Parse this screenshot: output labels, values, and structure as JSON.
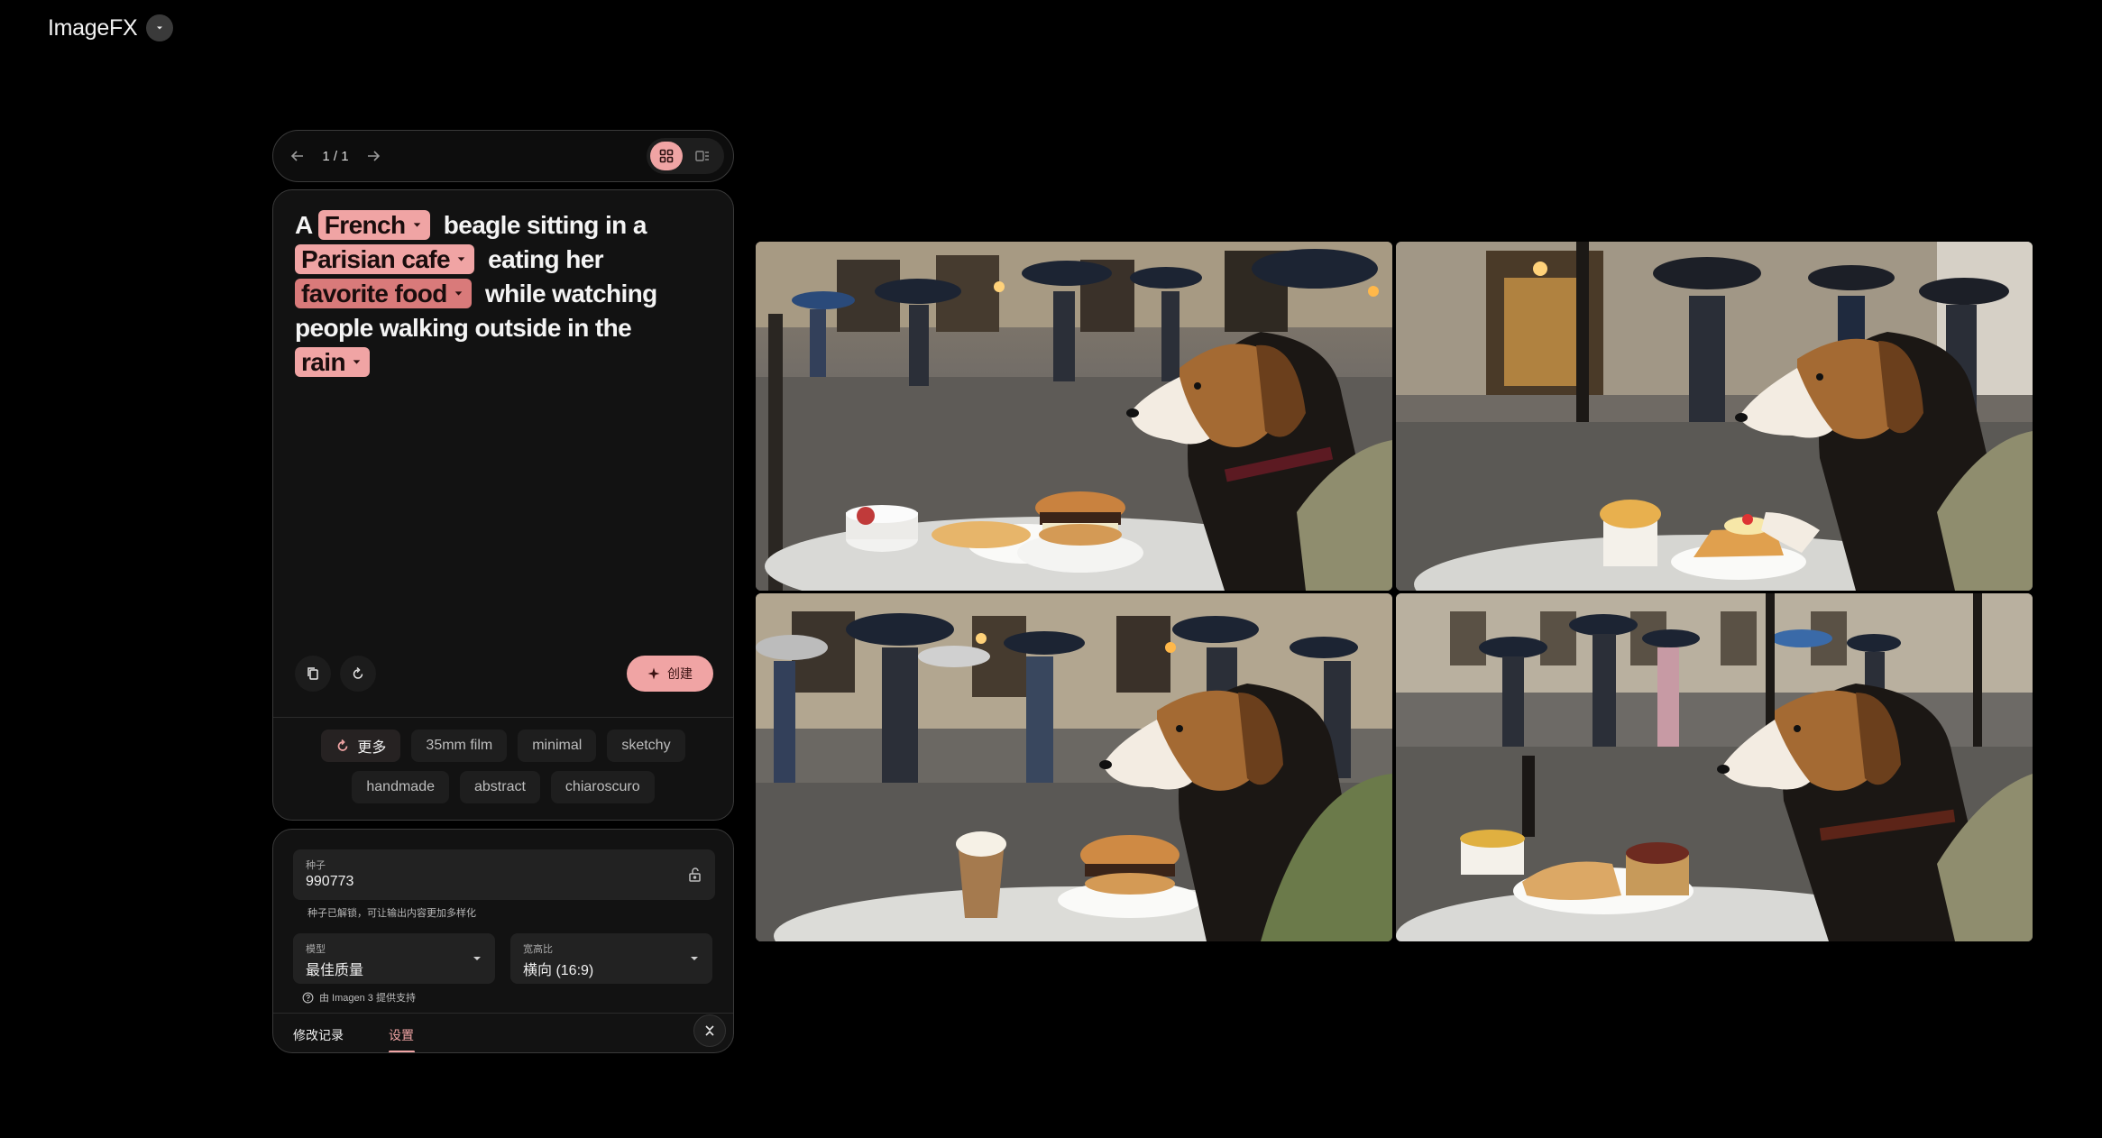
{
  "app": {
    "title": "ImageFX"
  },
  "pager": {
    "position": "1 / 1"
  },
  "prompt": {
    "segments": [
      {
        "type": "text",
        "value": "A"
      },
      {
        "type": "chip",
        "value": "French"
      },
      {
        "type": "text",
        "value": "beagle sitting in a"
      },
      {
        "type": "chip",
        "value": "Parisian cafe"
      },
      {
        "type": "text",
        "value": "eating her"
      },
      {
        "type": "chip",
        "value": "favorite food"
      },
      {
        "type": "text",
        "value": "while watching people walking outside in the"
      },
      {
        "type": "chip",
        "value": "rain"
      }
    ]
  },
  "actions": {
    "create_label": "创建"
  },
  "styles": {
    "more_label": "更多",
    "items": [
      "35mm film",
      "minimal",
      "sketchy",
      "handmade",
      "abstract",
      "chiaroscuro"
    ]
  },
  "settings": {
    "seed": {
      "label": "种子",
      "value": "990773",
      "hint": "种子已解锁，可让输出内容更加多样化"
    },
    "model": {
      "label": "模型",
      "value": "最佳质量"
    },
    "aspect_ratio": {
      "label": "宽高比",
      "value": "横向 (16:9)"
    },
    "powered_by": "由 Imagen 3 提供支持"
  },
  "tabs": {
    "history": "修改记录",
    "settings": "设置"
  },
  "colors": {
    "accent": "#f0a4a4",
    "background": "#000000",
    "card": "#121212"
  },
  "icons": [
    "chevron-down-icon",
    "arrow-left-icon",
    "arrow-right-icon",
    "grid-view-icon",
    "list-view-icon",
    "copy-icon",
    "reset-icon",
    "sparkle-icon",
    "refresh-icon",
    "unlock-icon",
    "info-icon",
    "collapse-icon"
  ],
  "gallery": {
    "images": [
      {
        "alt": "Beagle at cafe table eating a burger with fork, yogurt cup and bread, people with umbrellas behind"
      },
      {
        "alt": "Beagle at cafe table with pudding cup and cake, people with umbrellas on rainy street"
      },
      {
        "alt": "Beagle at cafe table with coffee cup and burger, pedestrians with umbrellas"
      },
      {
        "alt": "Beagle at cafe table with bread, tart and small bowls, rainy Paris street"
      }
    ]
  }
}
